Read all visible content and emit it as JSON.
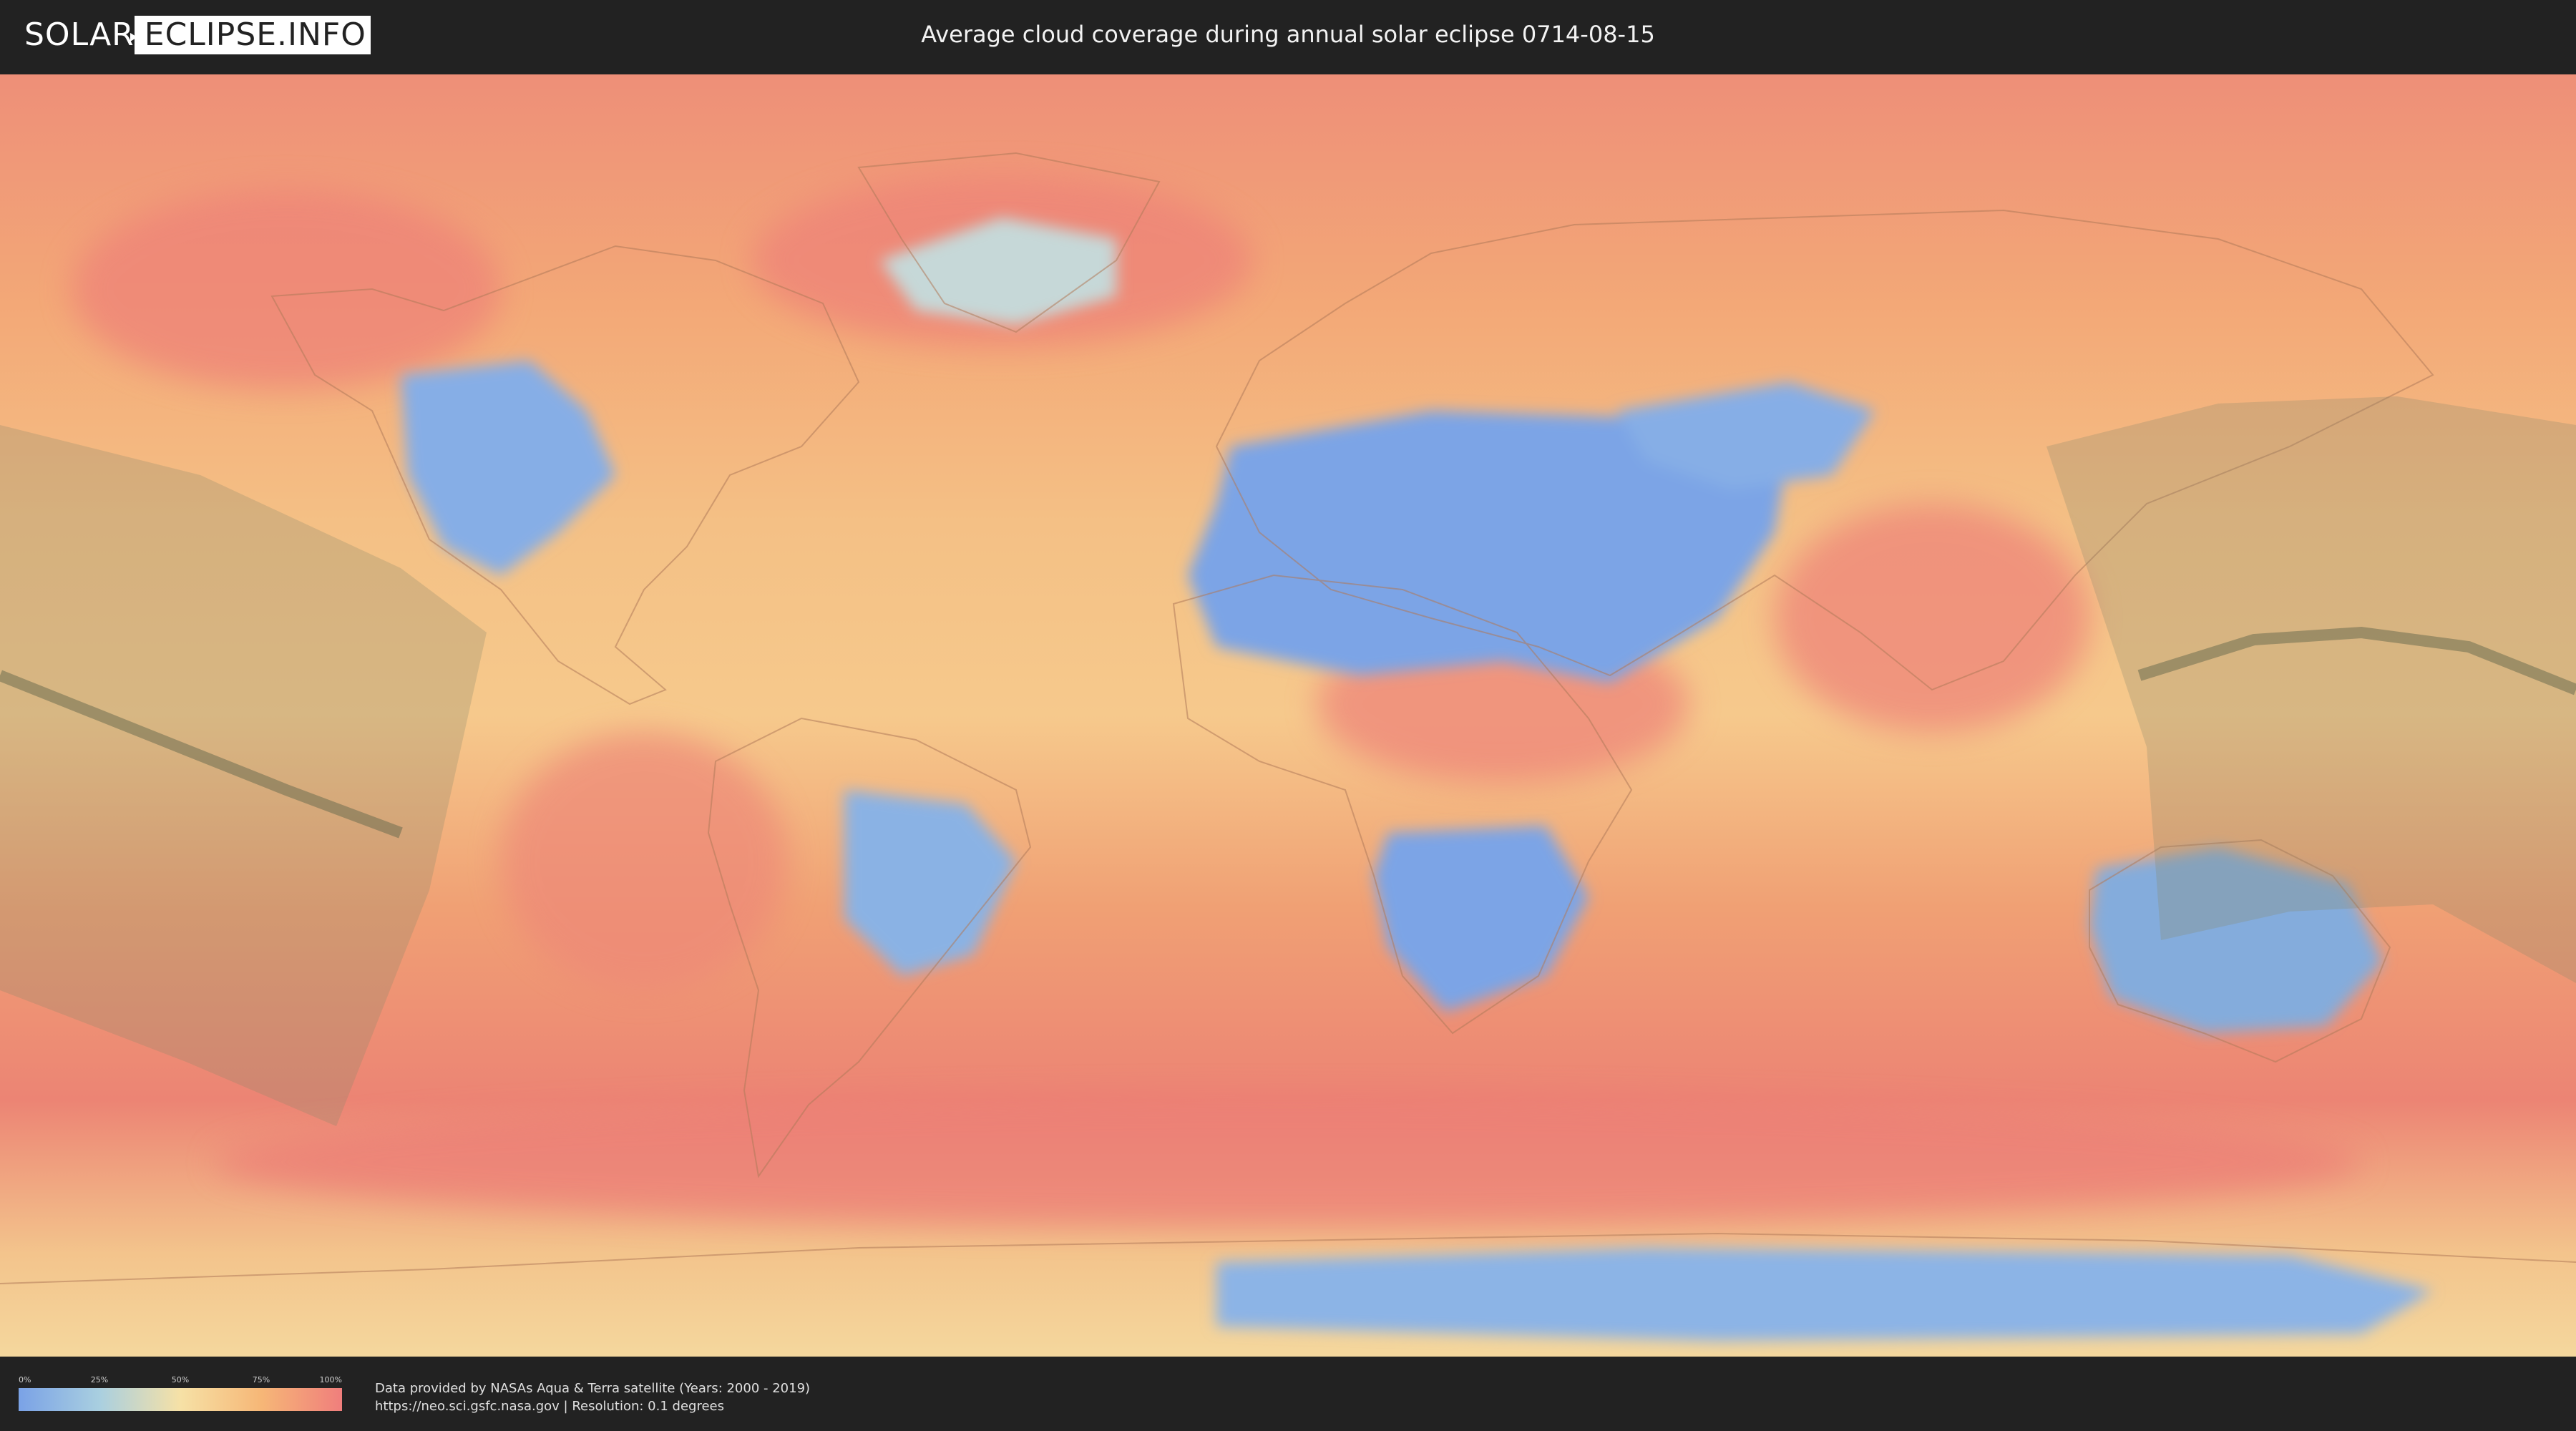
{
  "header": {
    "logo_left": "SOLAR",
    "logo_right": "ECLIPSE.INFO",
    "title": "Average cloud coverage during annual solar eclipse 0714-08-15"
  },
  "legend": {
    "ticks": [
      "0%",
      "25%",
      "50%",
      "75%",
      "100%"
    ],
    "colors": [
      "#7aa2e6",
      "#a9cfe0",
      "#f6e1a6",
      "#f6b777",
      "#f07e7c"
    ]
  },
  "footer": {
    "credit_line_1": "Data provided by NASAs Aqua & Terra satellite (Years: 2000 - 2019)",
    "credit_line_2": "https://neo.sci.gsfc.nasa.gov | Resolution: 0.1 degrees"
  },
  "map": {
    "clear_color": "#7aa2e6",
    "cloudy_color": "#f07e7c",
    "eclipse_band_color": "#8a8a6a"
  }
}
